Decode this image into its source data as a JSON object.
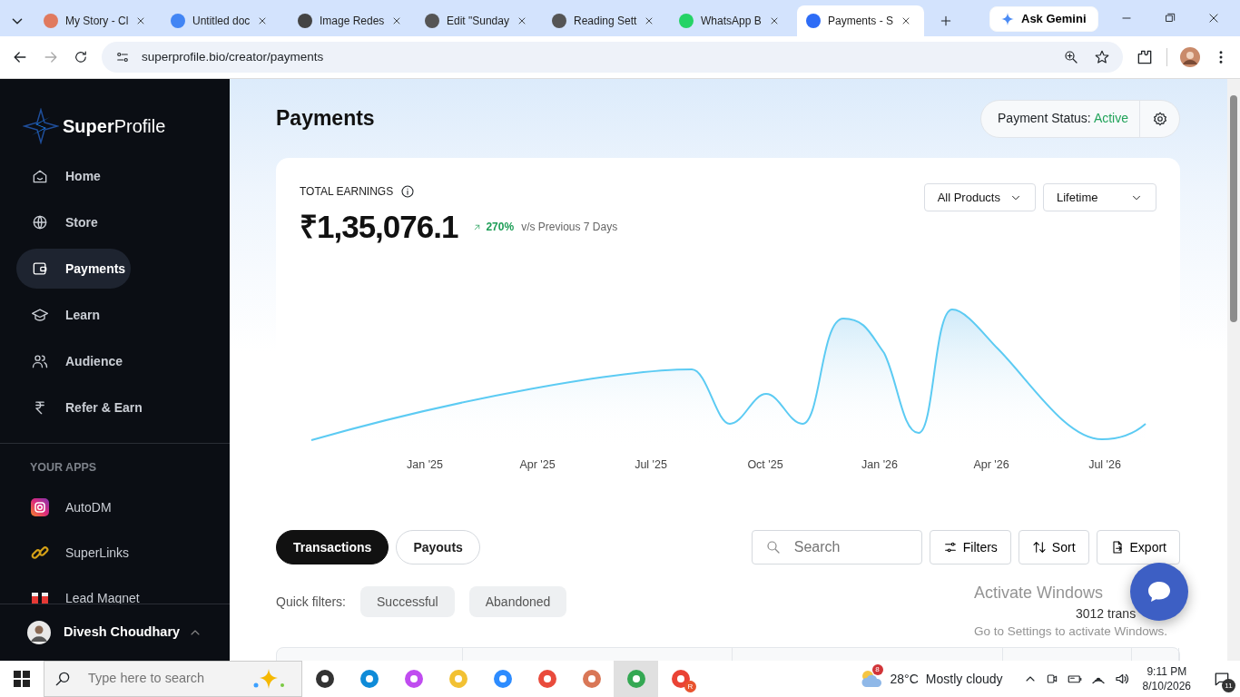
{
  "browser": {
    "tabs": [
      {
        "title": "My Story - Cl",
        "selected": false
      },
      {
        "title": "Untitled doc",
        "selected": false
      },
      {
        "title": "Image Redes",
        "selected": false
      },
      {
        "title": "Edit \"Sunday",
        "selected": false
      },
      {
        "title": "Reading Sett",
        "selected": false
      },
      {
        "title": "WhatsApp B",
        "selected": false
      },
      {
        "title": "Payments - S",
        "selected": true
      }
    ],
    "gemini_button": "Ask Gemini",
    "url": "superprofile.bio/creator/payments"
  },
  "sidebar": {
    "logo_bold": "Super",
    "logo_light": "Profile",
    "items": [
      {
        "label": "Home",
        "selected": false
      },
      {
        "label": "Store",
        "selected": false
      },
      {
        "label": "Payments",
        "selected": true
      },
      {
        "label": "Learn",
        "selected": false
      },
      {
        "label": "Audience",
        "selected": false
      },
      {
        "label": "Refer & Earn",
        "selected": false
      }
    ],
    "apps_heading": "YOUR APPS",
    "apps": [
      {
        "label": "AutoDM"
      },
      {
        "label": "SuperLinks"
      },
      {
        "label": "Lead Magnet"
      }
    ],
    "user": "Divesh Choudhary"
  },
  "page": {
    "title": "Payments",
    "status_label": "Payment Status:",
    "status_value": "Active"
  },
  "earnings": {
    "label": "TOTAL EARNINGS",
    "amount": "₹1,35,076.1",
    "change": "270%",
    "change_note": "v/s Previous 7 Days",
    "product_filter": "All Products",
    "period": "Lifetime",
    "axis_labels": [
      "Jan '25",
      "Apr '25",
      "Jul '25",
      "Oct '25",
      "Jan '26",
      "Apr '26",
      "Jul '26"
    ]
  },
  "tabs": [
    {
      "label": "Transactions",
      "selected": true
    },
    {
      "label": "Payouts",
      "selected": false
    }
  ],
  "search": {
    "placeholder": "Search"
  },
  "actions": [
    "Filters",
    "Sort",
    "Export"
  ],
  "quick_filters_label": "Quick filters:",
  "quick_filters": [
    "Successful",
    "Abandoned"
  ],
  "transaction_count": "3012 trans",
  "activation_notice": {
    "title": "Activate Windows",
    "text": "Go to Settings to activate Windows."
  },
  "taskbar": {
    "search_placeholder": "Type here to search",
    "weather_badge": "8",
    "temperature": "28°C",
    "weather": "Mostly cloudy",
    "profile_badge": "R",
    "time": "9:11 PM",
    "date": "8/10/2026",
    "notifications": "11"
  }
}
